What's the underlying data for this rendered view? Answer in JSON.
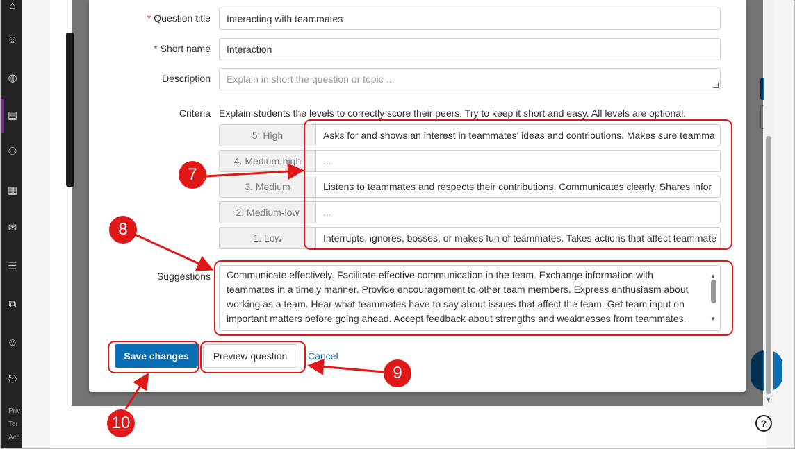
{
  "form": {
    "question_title": {
      "label": "Question title",
      "value": "Interacting with teammates"
    },
    "short_name": {
      "label": "Short name",
      "value": "Interaction"
    },
    "description": {
      "label": "Description",
      "placeholder": "Explain in short the question or topic ..."
    },
    "criteria": {
      "label": "Criteria",
      "help": "Explain students the levels to correctly score their peers. Try to keep it short and easy. All levels are optional.",
      "levels": [
        {
          "name": "5. High",
          "value": "Asks for and shows an interest in teammates' ideas and contributions. Makes sure teamma",
          "placeholder": ""
        },
        {
          "name": "4. Medium-high",
          "value": "",
          "placeholder": "..."
        },
        {
          "name": "3. Medium",
          "value": "Listens to teammates and respects their contributions. Communicates clearly. Shares infor",
          "placeholder": ""
        },
        {
          "name": "2. Medium-low",
          "value": "",
          "placeholder": "..."
        },
        {
          "name": "1. Low",
          "value": "Interrupts, ignores, bosses, or makes fun of teammates. Takes actions that affect teammate",
          "placeholder": ""
        }
      ]
    },
    "suggestions": {
      "label": "Suggestions",
      "value": "Communicate effectively. Facilitate effective communication in the team. Exchange information with teammates in a timely manner. Provide encouragement to other team members. Express enthusiasm about working as a team. Hear what teammates have to say about issues that affect the team. Get team input on important matters before going ahead. Accept feedback about strengths and weaknesses from teammates."
    },
    "buttons": {
      "save": "Save changes",
      "preview": "Preview question",
      "cancel": "Cancel"
    }
  },
  "annotations": {
    "badge_7": "7",
    "badge_8": "8",
    "badge_9": "9",
    "badge_10": "10",
    "color": "#e01818"
  },
  "leftnav": {
    "footer": [
      "Priv",
      "Ter",
      "Acc"
    ]
  },
  "colors": {
    "primary": "#0b6db3",
    "nav_bg": "#232323",
    "active": "#6a2c8a"
  }
}
